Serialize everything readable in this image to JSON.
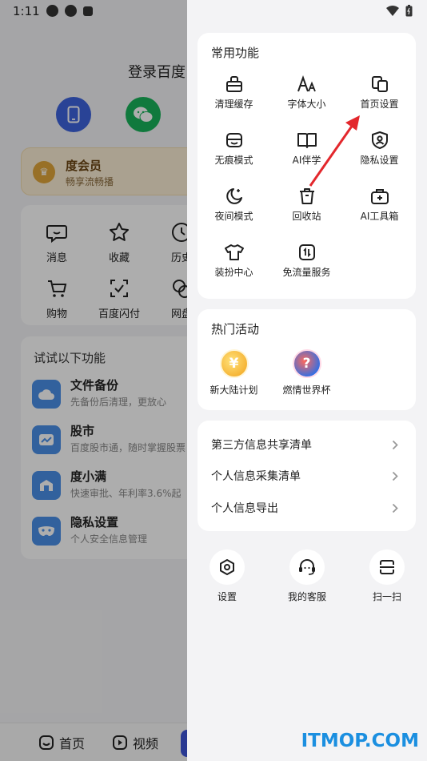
{
  "status_bar": {
    "time": "1:11"
  },
  "background": {
    "login_title": "登录百度",
    "vip": {
      "title": "度会员",
      "subtitle": "畅享流畅播"
    },
    "grid": [
      {
        "label": "消息",
        "icon": "message-icon"
      },
      {
        "label": "收藏",
        "icon": "star-icon"
      },
      {
        "label": "历史",
        "icon": "history-icon"
      },
      {
        "label": "购物",
        "icon": "cart-icon"
      },
      {
        "label": "百度闪付",
        "icon": "scan-pay-icon"
      },
      {
        "label": "网盘",
        "icon": "cloud-drive-icon"
      }
    ],
    "try_title": "试试以下功能",
    "try_items": [
      {
        "name": "文件备份",
        "desc": "先备份后清理，更放心",
        "icon": "cloud-icon"
      },
      {
        "name": "股市",
        "desc": "百度股市通，随时掌握股票",
        "icon": "stock-icon"
      },
      {
        "name": "度小满",
        "desc": "快速审批、年利率3.6%起",
        "icon": "finance-icon"
      },
      {
        "name": "隐私设置",
        "desc": "个人安全信息管理",
        "icon": "mask-icon"
      }
    ],
    "tabs": [
      {
        "label": "首页",
        "icon": "home-icon"
      },
      {
        "label": "视频",
        "icon": "video-icon"
      }
    ]
  },
  "drawer": {
    "common": {
      "title": "常用功能",
      "items": [
        {
          "label": "清理缓存",
          "icon": "clean-cache-icon"
        },
        {
          "label": "字体大小",
          "icon": "font-size-icon"
        },
        {
          "label": "首页设置",
          "icon": "home-settings-icon"
        },
        {
          "label": "无痕模式",
          "icon": "incognito-icon"
        },
        {
          "label": "AI伴学",
          "icon": "book-icon"
        },
        {
          "label": "隐私设置",
          "icon": "privacy-shield-icon"
        },
        {
          "label": "夜间模式",
          "icon": "moon-icon"
        },
        {
          "label": "回收站",
          "icon": "trash-icon"
        },
        {
          "label": "AI工具箱",
          "icon": "toolbox-icon"
        },
        {
          "label": "装扮中心",
          "icon": "tshirt-icon"
        },
        {
          "label": "免流量服务",
          "icon": "data-free-icon"
        }
      ]
    },
    "activities": {
      "title": "热门活动",
      "items": [
        {
          "label": "新大陆计划",
          "icon": "new-continent-icon"
        },
        {
          "label": "燃情世界杯",
          "icon": "world-cup-icon"
        }
      ]
    },
    "info_list": [
      {
        "label": "第三方信息共享清单"
      },
      {
        "label": "个人信息采集清单"
      },
      {
        "label": "个人信息导出"
      }
    ],
    "bottom": [
      {
        "label": "设置",
        "icon": "settings-icon"
      },
      {
        "label": "我的客服",
        "icon": "customer-service-icon"
      },
      {
        "label": "扫一扫",
        "icon": "scan-icon"
      }
    ]
  },
  "watermark": "ITMOP.COM",
  "colors": {
    "accent": "#3d63dd",
    "arrow": "#e3272c",
    "wechat": "#19b35a",
    "watermark": "#1b8fe0"
  }
}
